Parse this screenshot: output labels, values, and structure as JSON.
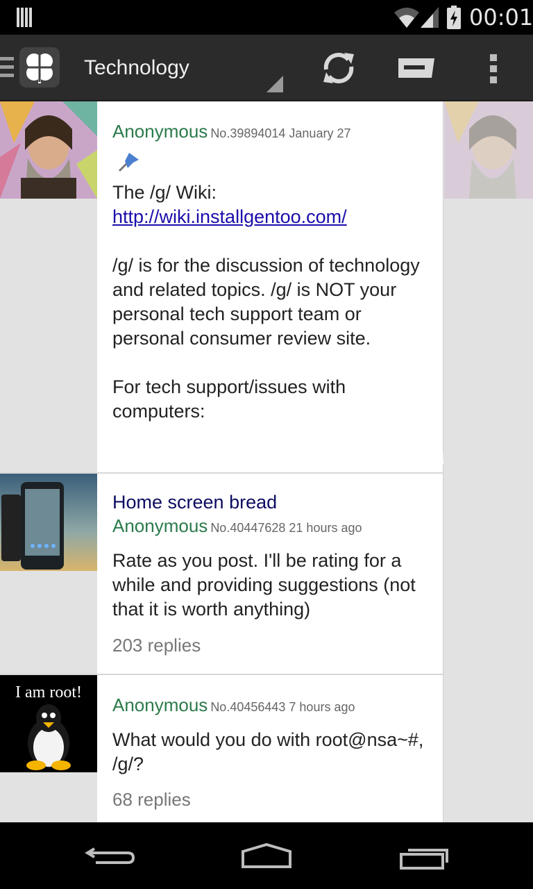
{
  "status_bar": {
    "time": "00:01",
    "icons": [
      "notification-icon",
      "wifi-icon",
      "signal-icon",
      "battery-charging-icon"
    ]
  },
  "action_bar": {
    "board_title": "Technology",
    "icons": [
      "drawer-icon",
      "app-logo-icon",
      "refresh-icon",
      "reply-icon",
      "overflow-menu-icon"
    ]
  },
  "threads": [
    {
      "name": "Anonymous",
      "meta": "No.39894014 January 27",
      "sticky": true,
      "body_line": "The /g/ Wiki:",
      "link": "http://wiki.installgentoo.com/",
      "paragraph_1": "/g/ is for the discussion of technology and related topics. /g/ is NOT your personal tech support team or personal consumer review site.",
      "paragraph_2": "For tech support/issues with computers:"
    },
    {
      "subject": "Home screen bread",
      "name": "Anonymous",
      "meta": "No.40447628 21 hours ago",
      "body": "Rate as you post. I'll be rating for a while and providing suggestions (not that it is worth anything)",
      "replies": "203 replies"
    },
    {
      "name": "Anonymous",
      "meta": "No.40456443 7 hours ago",
      "body": "What would you do with root@nsa~#, /g/?",
      "replies": "68 replies",
      "thumb_caption": "I am root!"
    }
  ],
  "colors": {
    "accent_name": "#2b7a4b",
    "subject": "#0c0c62",
    "link": "#1a0dab",
    "action_bar": "#2b2b2b"
  }
}
